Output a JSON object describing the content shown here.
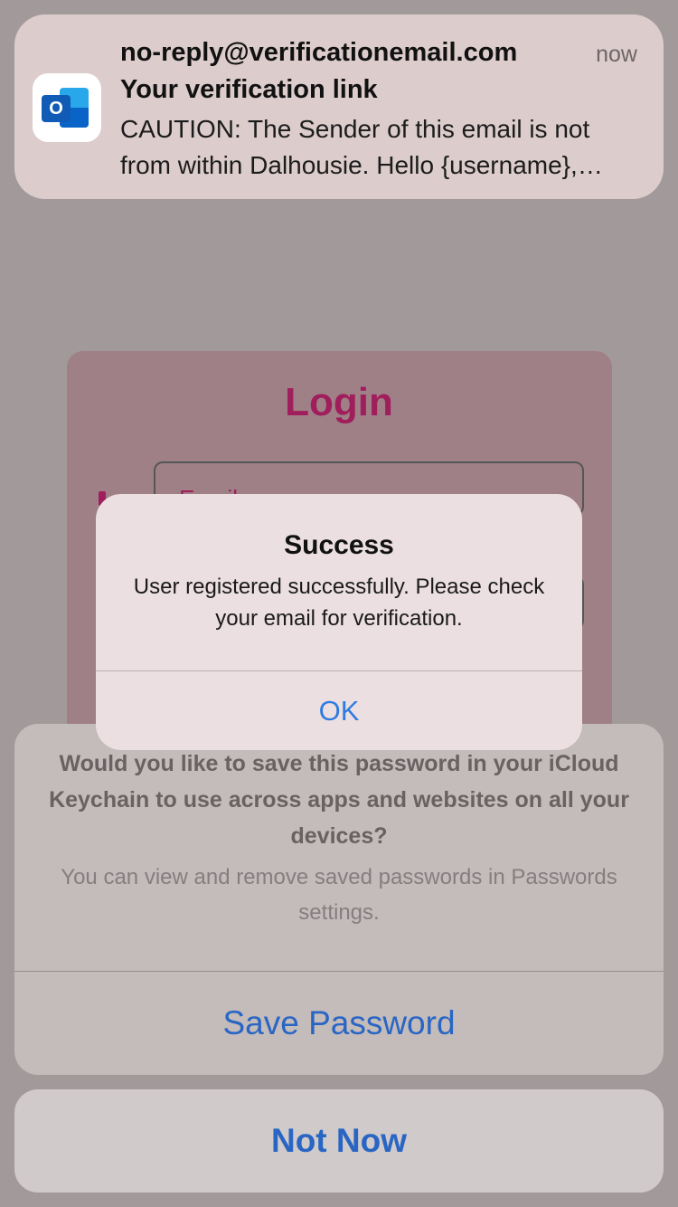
{
  "notification": {
    "app_icon": "outlook-icon",
    "sender": "no-reply@verificationemail.com",
    "time": "now",
    "subject": "Your verification link",
    "preview": "CAUTION: The Sender of this email is not from within Dalhousie. Hello {username}, please verify your email address."
  },
  "background_app": {
    "title": "Login",
    "email_placeholder": "Email"
  },
  "alert": {
    "title": "Success",
    "message": "User registered successfully. Please check your email for verification.",
    "ok_label": "OK"
  },
  "keychain_sheet": {
    "question": "Would you like to save this password in your iCloud Keychain to use across apps and websites on all your devices?",
    "info": "You can view and remove saved passwords in Passwords settings.",
    "save_label": "Save Password",
    "not_now_label": "Not Now"
  },
  "colors": {
    "accent_blue": "#2966c4",
    "login_accent": "#a01e5c",
    "dim_background": "#a2999a"
  }
}
